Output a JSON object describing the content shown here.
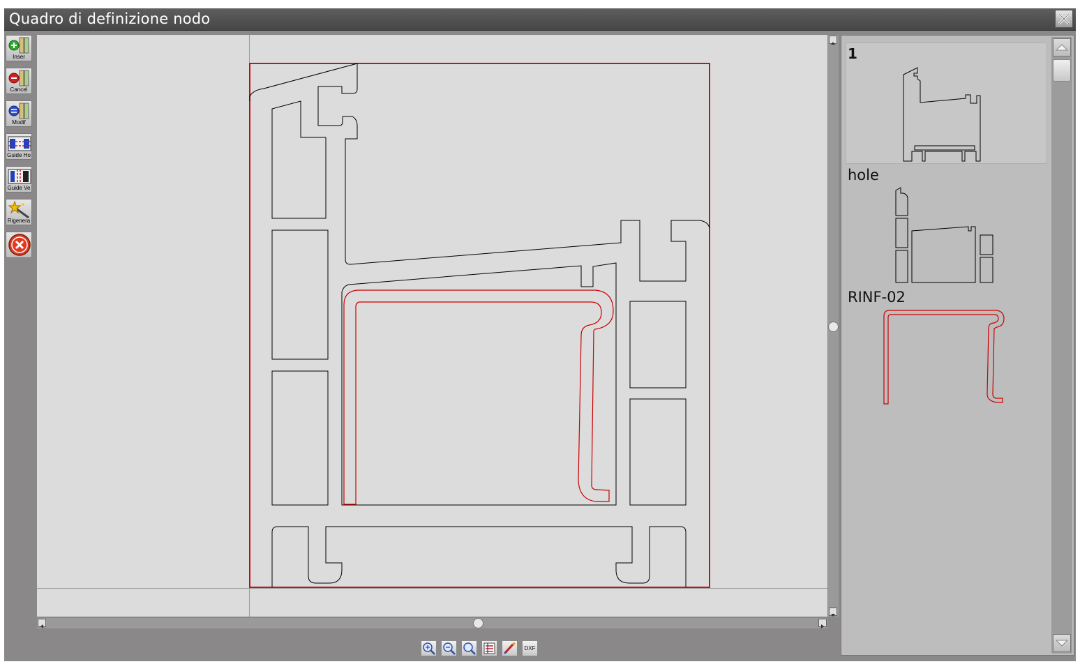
{
  "window": {
    "title": "Quadro di definizione nodo"
  },
  "toolbar": {
    "items": [
      {
        "label": "Inser",
        "icon": "insert-icon"
      },
      {
        "label": "Cancel",
        "icon": "delete-icon"
      },
      {
        "label": "Modif",
        "icon": "modify-icon"
      },
      {
        "label": "Guide Ho",
        "icon": "horizontal-guide-icon"
      },
      {
        "label": "Guide Ve",
        "icon": "vertical-guide-icon"
      },
      {
        "label": "Rigenera",
        "icon": "magic-wand-icon"
      },
      {
        "label": "",
        "icon": "exit-icon"
      }
    ]
  },
  "bottom_tools": [
    {
      "icon": "zoom-in-icon"
    },
    {
      "icon": "zoom-out-icon"
    },
    {
      "icon": "zoom-fit-icon"
    },
    {
      "icon": "layers-icon"
    },
    {
      "icon": "brush-icon"
    },
    {
      "icon": "dxf-icon",
      "label": "DXF"
    }
  ],
  "profiles_panel": {
    "items": [
      {
        "label": "1",
        "selected": true
      },
      {
        "label": "hole",
        "selected": false
      },
      {
        "label": "RINF-02",
        "selected": false
      }
    ]
  },
  "colors": {
    "profile_outline": "#000000",
    "reinforcement": "#cc0000",
    "frame": "#c00000"
  }
}
